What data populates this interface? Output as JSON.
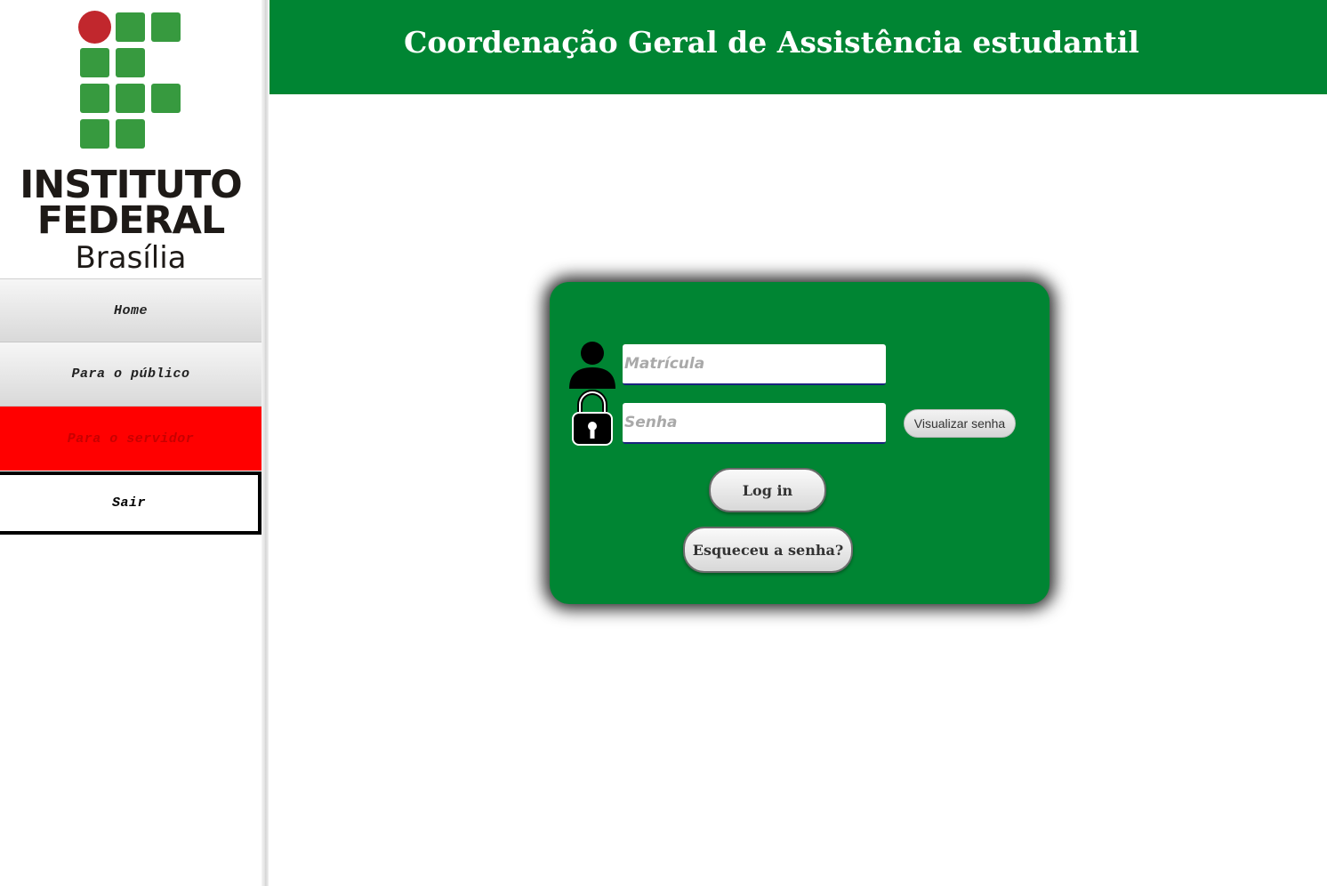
{
  "logo": {
    "line1": "INSTITUTO",
    "line2": "FEDERAL",
    "line3": "Brasília",
    "colors": {
      "squares": "#379a3f",
      "dot": "#c1272d"
    }
  },
  "nav": {
    "items": [
      {
        "label": "Home"
      },
      {
        "label": "Para o público"
      },
      {
        "label": "Para o servidor"
      },
      {
        "label": "Sair"
      }
    ]
  },
  "header": {
    "title": "Coordenação Geral de Assistência estudantil",
    "color": "#008533"
  },
  "login": {
    "matricula_placeholder": "Matrícula",
    "senha_placeholder": "Senha",
    "visualizar_label": "Visualizar senha",
    "login_label": "Log in",
    "forgot_label": "Esqueceu a senha?",
    "icons": {
      "user": "user-icon",
      "lock": "lock-icon"
    }
  }
}
